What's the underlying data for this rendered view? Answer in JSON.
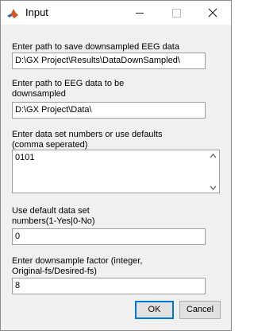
{
  "window": {
    "title": "Input",
    "app_icon": "matlab-icon",
    "controls": [
      "minimize-icon",
      "maximize-icon",
      "close-icon"
    ]
  },
  "fields": [
    {
      "label": "Enter path to save downsampled EEG data",
      "value": "D:\\GX Project\\Results\\DataDownSampled\\"
    },
    {
      "label": "Enter path to EEG data to be downsampled",
      "value": "D:\\GX Project\\Data\\"
    },
    {
      "label": "Enter data set numbers  or use defaults (comma seperated)",
      "value": "0101"
    },
    {
      "label": "Use default data set numbers(1-Yes|0-No)",
      "value": "0"
    },
    {
      "label": "Enter downsample factor (integer, Original-fs/Desired-fs)",
      "value": "8"
    }
  ],
  "buttons": {
    "ok": "OK",
    "cancel": "Cancel"
  }
}
